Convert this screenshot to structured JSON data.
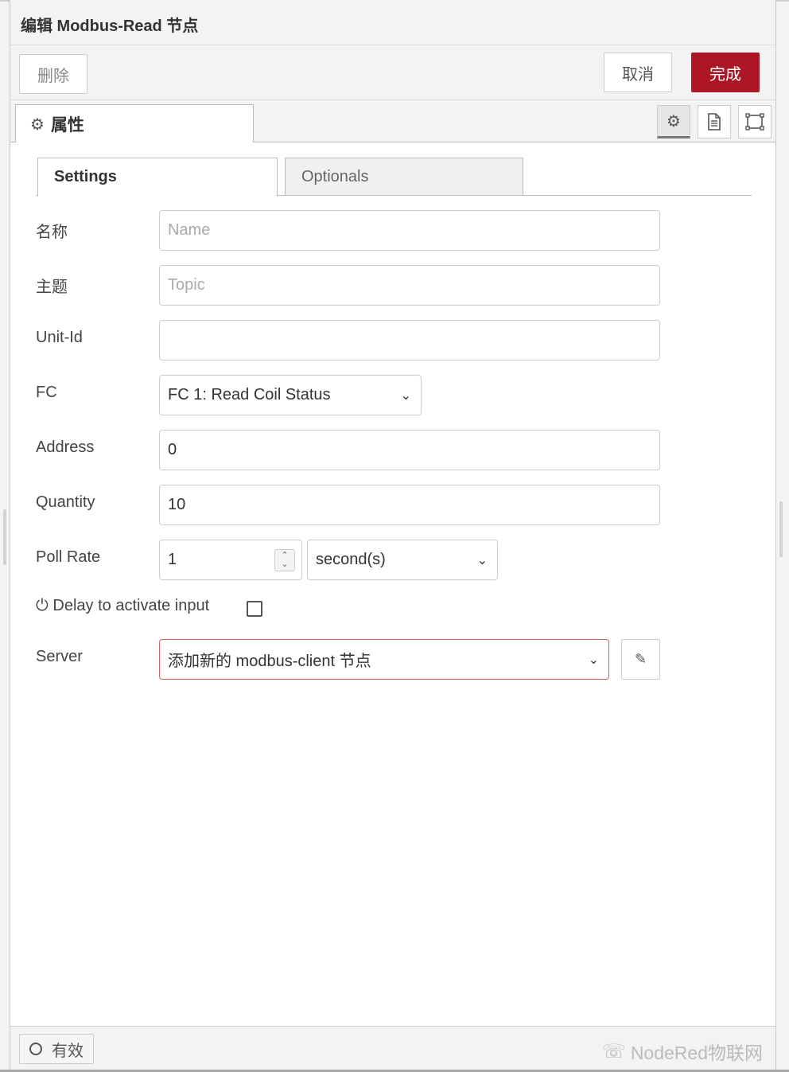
{
  "window": {
    "title": "编辑 Modbus-Read 节点"
  },
  "toolbar": {
    "delete_label": "删除",
    "cancel_label": "取消",
    "done_label": "完成"
  },
  "tabs": {
    "properties_label": "属性",
    "properties_icon": "gear-icon"
  },
  "view_buttons": [
    {
      "icon": "gear-icon",
      "active": true
    },
    {
      "icon": "document-icon",
      "active": false
    },
    {
      "icon": "frame-icon",
      "active": false
    }
  ],
  "subtabs": {
    "settings": "Settings",
    "optionals": "Optionals"
  },
  "form": {
    "name": {
      "label": "名称",
      "value": "",
      "placeholder": "Name"
    },
    "topic": {
      "label": "主题",
      "value": "",
      "placeholder": "Topic"
    },
    "unit_id": {
      "label": "Unit-Id",
      "value": ""
    },
    "fc": {
      "label": "FC",
      "selected": "FC 1: Read Coil Status"
    },
    "address": {
      "label": "Address",
      "value": "0"
    },
    "quantity": {
      "label": "Quantity",
      "value": "10"
    },
    "poll_rate": {
      "label": "Poll Rate",
      "value": "1",
      "unit": "second(s)"
    },
    "delay": {
      "label": "Delay to activate input",
      "checked": false
    },
    "server": {
      "label": "Server",
      "selected": "添加新的 modbus-client 节点"
    }
  },
  "footer": {
    "enabled_label": "有效",
    "watermark": "NodeRed物联网"
  },
  "colors": {
    "primary": "#ad1625",
    "error_border": "#d6615e"
  }
}
